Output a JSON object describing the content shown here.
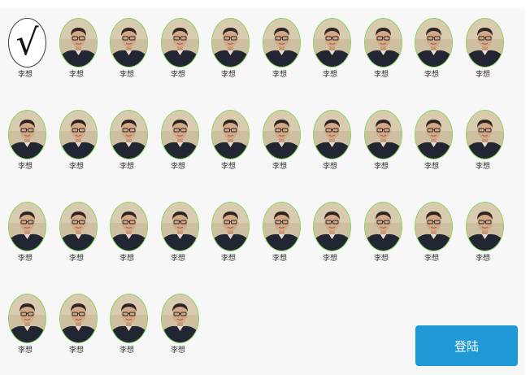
{
  "selected_avatar": {
    "mark": "√",
    "icon": "checkmark-icon"
  },
  "avatars": [
    {
      "name": "李想"
    },
    {
      "name": "李想"
    },
    {
      "name": "李想"
    },
    {
      "name": "李想"
    },
    {
      "name": "李想"
    },
    {
      "name": "李想"
    },
    {
      "name": "李想"
    },
    {
      "name": "李想"
    },
    {
      "name": "李想"
    },
    {
      "name": "李想"
    },
    {
      "name": "李想"
    },
    {
      "name": "李想"
    },
    {
      "name": "李想"
    },
    {
      "name": "李想"
    },
    {
      "name": "李想"
    },
    {
      "name": "李想"
    },
    {
      "name": "李想"
    },
    {
      "name": "李想"
    },
    {
      "name": "李想"
    },
    {
      "name": "李想"
    },
    {
      "name": "李想"
    },
    {
      "name": "李想"
    },
    {
      "name": "李想"
    },
    {
      "name": "李想"
    },
    {
      "name": "李想"
    },
    {
      "name": "李想"
    },
    {
      "name": "李想"
    },
    {
      "name": "李想"
    },
    {
      "name": "李想"
    },
    {
      "name": "李想"
    },
    {
      "name": "李想"
    },
    {
      "name": "李想"
    },
    {
      "name": "李想"
    },
    {
      "name": "李想"
    }
  ],
  "login_button": {
    "label": "登陆",
    "color": "#1e99d6"
  },
  "colors": {
    "frame_border": "#7ed957",
    "panel_background": "#f7f7f7"
  }
}
